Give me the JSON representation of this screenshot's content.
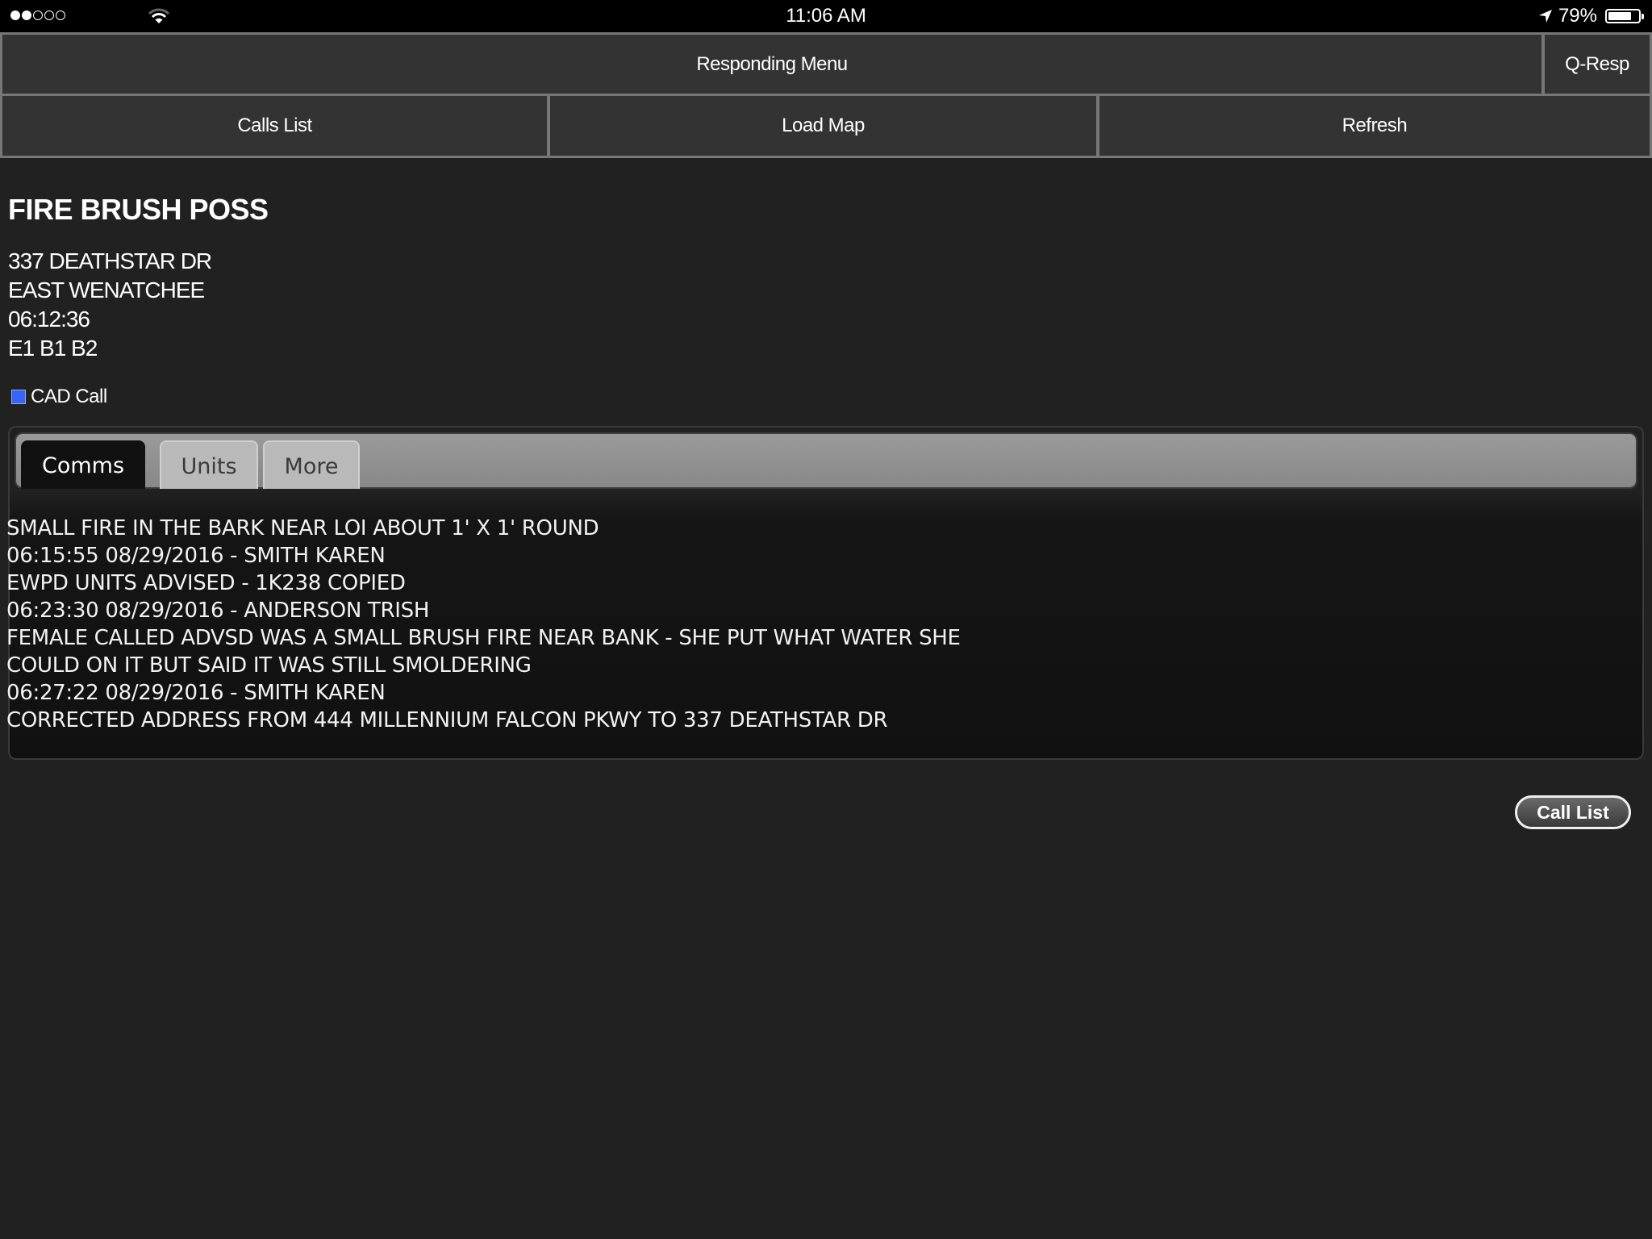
{
  "status_bar": {
    "signal_bars_filled": 2,
    "signal_bars_total": 5,
    "wifi_icon": "wifi-icon",
    "time": "11:06 AM",
    "location_icon": "location-arrow-icon",
    "battery_percent_text": "79%",
    "battery_level": 0.79
  },
  "nav": {
    "responding_menu": "Responding Menu",
    "q_resp": "Q-Resp",
    "calls_list": "Calls List",
    "load_map": "Load Map",
    "refresh": "Refresh"
  },
  "call": {
    "title": "FIRE BRUSH POSS",
    "address": "337 DEATHSTAR DR",
    "city": "EAST WENATCHEE",
    "time": "06:12:36",
    "units": "E1 B1 B2",
    "cad_label": "CAD Call",
    "cad_color": "#3366ff"
  },
  "tabs": {
    "items": [
      {
        "label": "Comms",
        "active": true
      },
      {
        "label": "Units",
        "active": false
      },
      {
        "label": "More",
        "active": false
      }
    ]
  },
  "comms": {
    "lines": [
      "SMALL FIRE IN THE BARK NEAR LOI ABOUT 1' X 1' ROUND",
      "06:15:55 08/29/2016 - SMITH KAREN",
      "EWPD UNITS ADVISED - 1K238 COPIED",
      "06:23:30 08/29/2016 - ANDERSON TRISH",
      "FEMALE CALLED ADVSD WAS A SMALL BRUSH FIRE NEAR BANK - SHE PUT WHAT WATER SHE",
      "COULD ON IT BUT SAID IT WAS STILL SMOLDERING",
      "06:27:22 08/29/2016 - SMITH KAREN",
      "CORRECTED ADDRESS FROM 444 MILLENNIUM FALCON PKWY TO 337 DEATHSTAR DR"
    ]
  },
  "footer": {
    "call_list_button": "Call List"
  }
}
